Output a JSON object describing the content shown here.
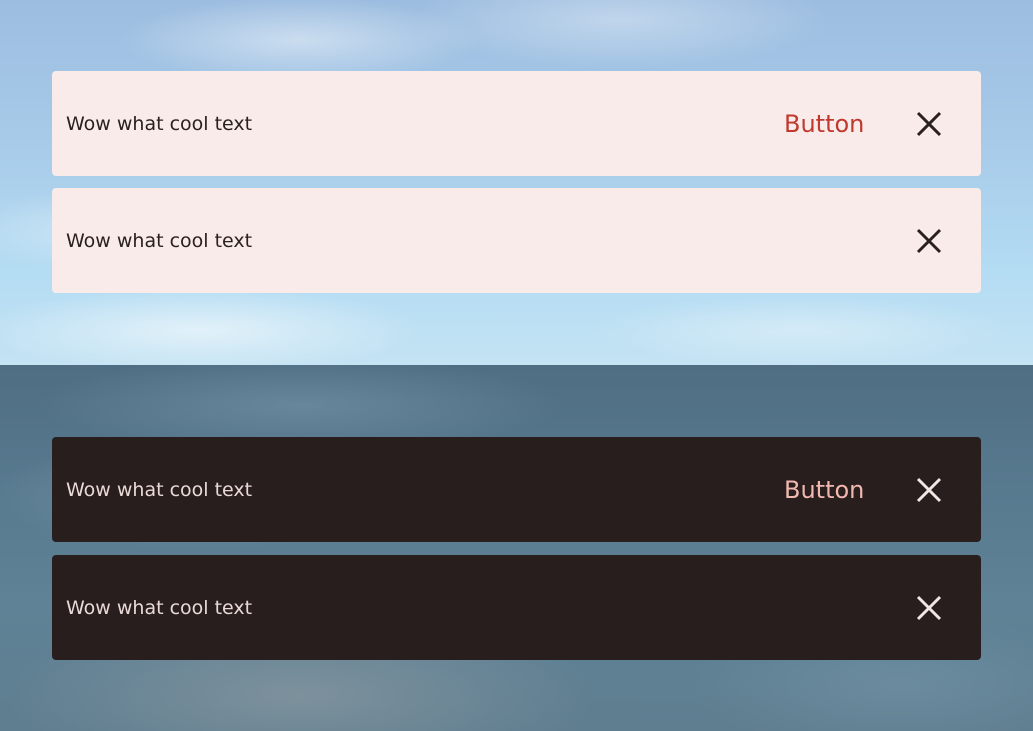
{
  "light": {
    "toast_with_action": {
      "message": "Wow what cool text",
      "action_label": "Button",
      "close_icon": "close-icon"
    },
    "toast_simple": {
      "message": "Wow what cool text",
      "close_icon": "close-icon"
    }
  },
  "dark": {
    "toast_with_action": {
      "message": "Wow what cool text",
      "action_label": "Button",
      "close_icon": "close-icon"
    },
    "toast_simple": {
      "message": "Wow what cool text",
      "close_icon": "close-icon"
    }
  },
  "colors": {
    "light_surface": "#f8ebea",
    "light_text": "#2a211f",
    "light_action": "#c0392e",
    "dark_surface": "#271e1d",
    "dark_text": "#ead9d6",
    "dark_action": "#f2b8b0"
  }
}
